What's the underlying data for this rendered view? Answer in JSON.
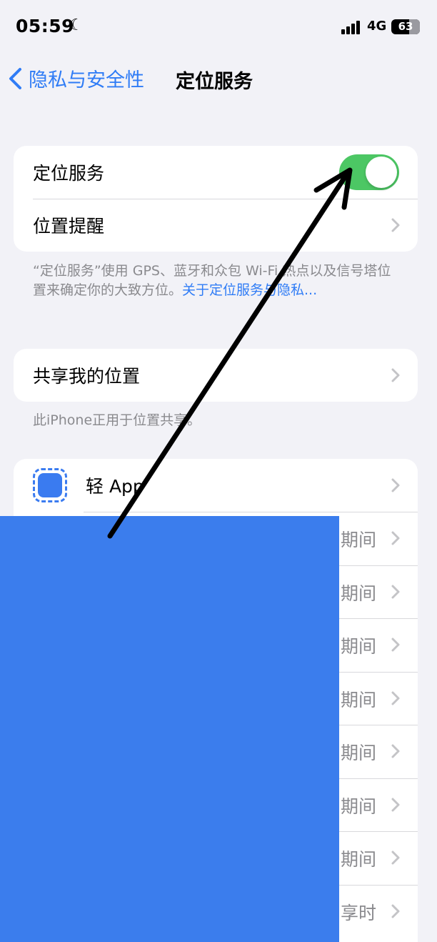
{
  "status": {
    "time": "05:59",
    "network": "4G",
    "battery": "63",
    "moon_icon": "moon-icon"
  },
  "nav": {
    "back_label": "隐私与安全性",
    "title": "定位服务"
  },
  "group1": {
    "location_services": "定位服务",
    "location_alerts": "位置提醒",
    "toggle_on": true
  },
  "footnote1": {
    "text": "“定位服务”使用 GPS、蓝牙和众包 Wi-Fi 热点以及信号塔位置来确定你的大致方位。",
    "link": "关于定位服务与隐私..."
  },
  "group2": {
    "share_location": "共享我的位置"
  },
  "footnote2": {
    "text": "此iPhone正用于位置共享。"
  },
  "apps": {
    "first_app": "轻 App",
    "rows": [
      {
        "value": "期间"
      },
      {
        "value": "期间"
      },
      {
        "value": "期间"
      },
      {
        "value": "期间"
      },
      {
        "value": "期间"
      },
      {
        "value": "期间"
      },
      {
        "value": "期间"
      },
      {
        "value": "享时"
      }
    ]
  },
  "colors": {
    "accent": "#2f7cf6",
    "toggle_on": "#4cc764",
    "redaction": "#3b7ded",
    "background": "#f2f2f7"
  }
}
